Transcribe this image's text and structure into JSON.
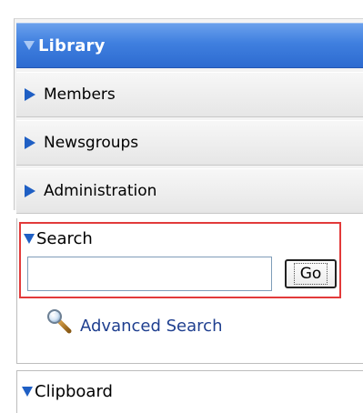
{
  "nav": {
    "active": {
      "label": "Library",
      "icon": "triangle-down-icon"
    },
    "items": [
      {
        "label": "Members",
        "icon": "triangle-right-icon"
      },
      {
        "label": "Newsgroups",
        "icon": "triangle-right-icon"
      },
      {
        "label": "Administration",
        "icon": "triangle-right-icon"
      }
    ]
  },
  "search": {
    "title": "Search",
    "input_value": "",
    "go_label": "Go",
    "advanced_label": "Advanced Search",
    "advanced_icon": "magnifier-icon"
  },
  "clipboard": {
    "title": "Clipboard"
  },
  "colors": {
    "header_blue": "#3f7fdf",
    "triangle_blue": "#1f5fc4",
    "highlight_red": "#e23a3a",
    "link_blue": "#1f3f8f"
  }
}
